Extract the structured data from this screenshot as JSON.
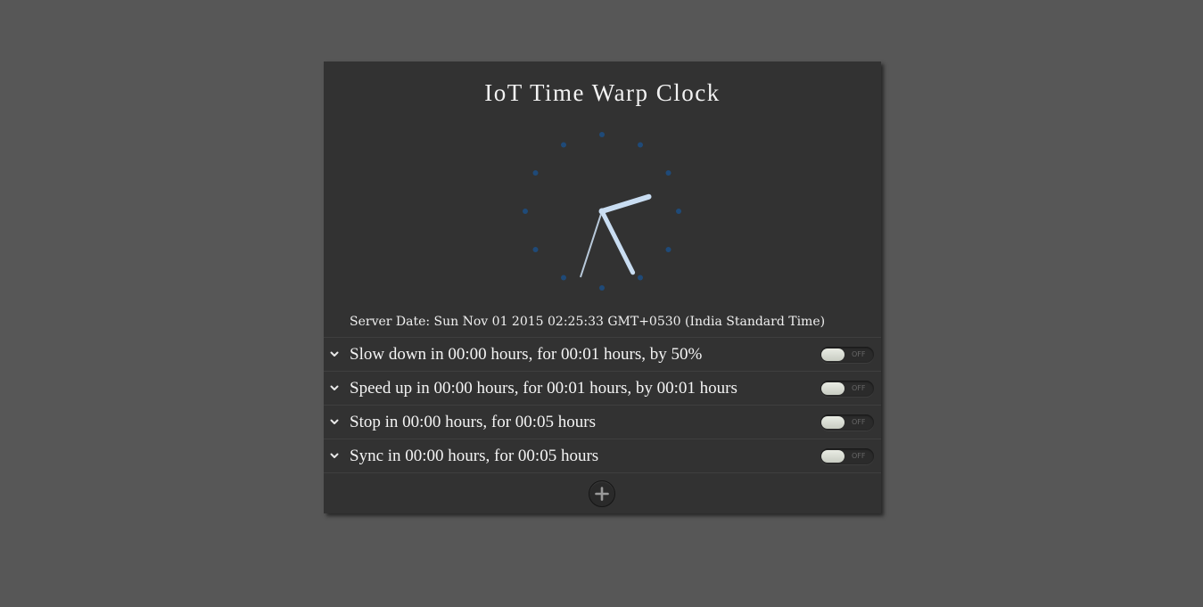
{
  "app": {
    "title": "IoT Time Warp Clock"
  },
  "clock": {
    "time": "02:25:33",
    "marker_color": "#1f4a78",
    "hand_color": "#c9ddf2",
    "second_hand_color": "#b8c9da"
  },
  "server_date": "Server Date: Sun Nov 01 2015 02:25:33 GMT+0530 (India Standard Time)",
  "rules": [
    {
      "label": "Slow down in 00:00 hours, for 00:01 hours, by 50%",
      "toggle": "OFF"
    },
    {
      "label": "Speed up in 00:00 hours, for 00:01 hours, by 00:01 hours",
      "toggle": "OFF"
    },
    {
      "label": "Stop in 00:00 hours, for 00:05 hours",
      "toggle": "OFF"
    },
    {
      "label": "Sync in 00:00 hours, for 00:05 hours",
      "toggle": "OFF"
    }
  ],
  "add_button": {
    "icon": "plus-icon"
  },
  "colors": {
    "background": "#575757",
    "panel": "#323232",
    "text": "#f4f4f4"
  }
}
